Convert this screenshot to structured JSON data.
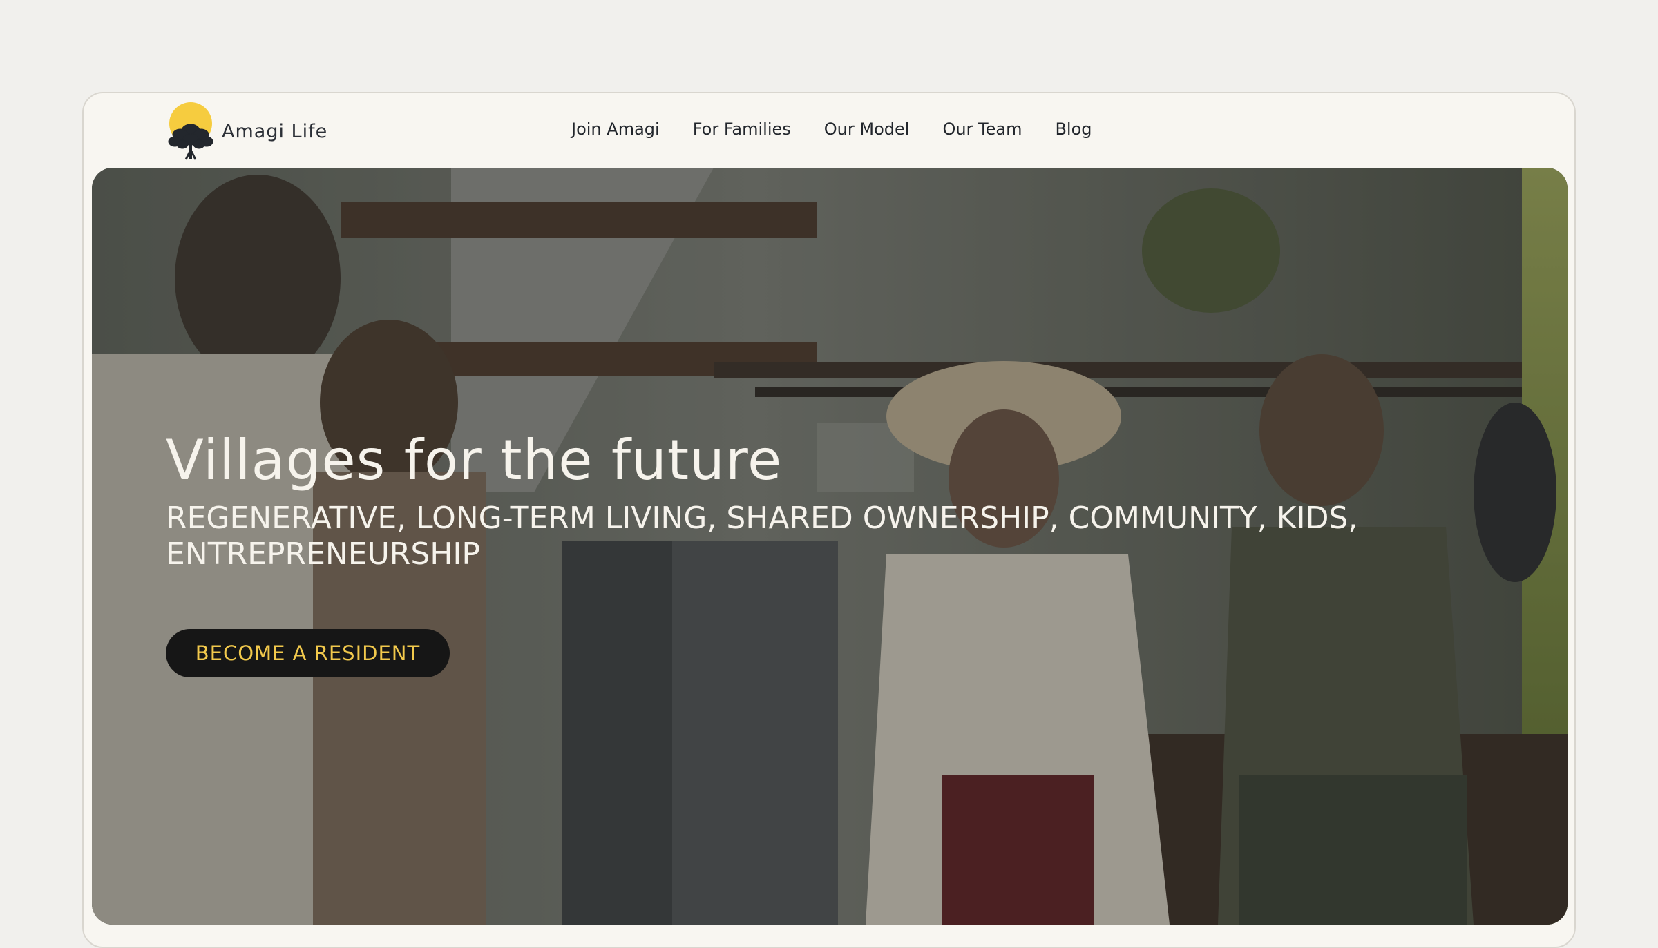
{
  "brand": {
    "name": "Amagi Life",
    "logo_icon": "sun-tree-icon",
    "sun_color": "#f6cc3f",
    "tree_color": "#23272d"
  },
  "nav": {
    "links": [
      {
        "label": "Join Amagi"
      },
      {
        "label": "For Families"
      },
      {
        "label": "Our Model"
      },
      {
        "label": "Our Team"
      },
      {
        "label": "Blog"
      }
    ]
  },
  "hero": {
    "title": "Villages for the future",
    "subtitle": "REGENERATIVE, LONG-TERM LIVING, SHARED OWNERSHIP, COMMUNITY, KIDS, ENTREPRENEURSHIP",
    "cta_label": "BECOME A RESIDENT",
    "cta_text_color": "#f2c94c",
    "cta_bg_color": "#161616"
  }
}
